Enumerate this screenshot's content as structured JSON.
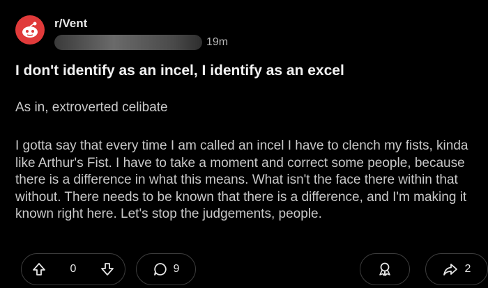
{
  "post": {
    "subreddit": "r/Vent",
    "time_ago": "19m",
    "title": "I don't identify as an incel, I identify as an excel",
    "subtitle": "As in, extroverted celibate",
    "body": "I gotta say that every time I am called an incel I have to clench my fists, kinda like Arthur's Fist. I have to take a moment and correct some people, because there is a difference in what this means. What isn't the face there within that without. There needs to be known that there is a difference, and I'm making it known right here. Let's stop the judgements, people."
  },
  "actions": {
    "vote_count": "0",
    "comment_count": "9",
    "share_count": "2"
  },
  "icons": {
    "avatar": "subreddit-avatar-icon",
    "upvote": "upvote-arrow-icon",
    "downvote": "downvote-arrow-icon",
    "comment": "comment-bubble-icon",
    "award": "award-icon",
    "share": "share-arrow-icon"
  },
  "colors": {
    "background": "#000000",
    "avatar": "#e03a3a",
    "text": "#c9c9c9",
    "border": "#3b3b3b"
  }
}
